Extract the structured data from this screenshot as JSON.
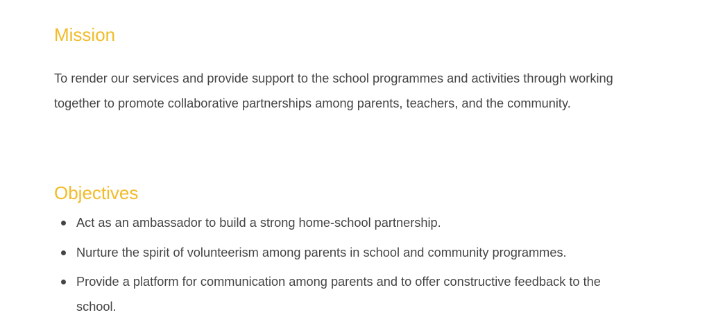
{
  "mission": {
    "heading": "Mission",
    "text": "To render our services and provide support to the school programmes and activities through working together to promote collaborative partnerships among parents, teachers, and the community."
  },
  "objectives": {
    "heading": "Objectives",
    "items": [
      "Act as an ambassador to build a strong home-school partnership.",
      "Nurture the spirit of volunteerism among parents in school and community programmes.",
      "Provide a platform for communication among parents and to offer constructive feedback to the school."
    ]
  },
  "colors": {
    "heading": "#f2bb28",
    "body_text": "#444444"
  }
}
